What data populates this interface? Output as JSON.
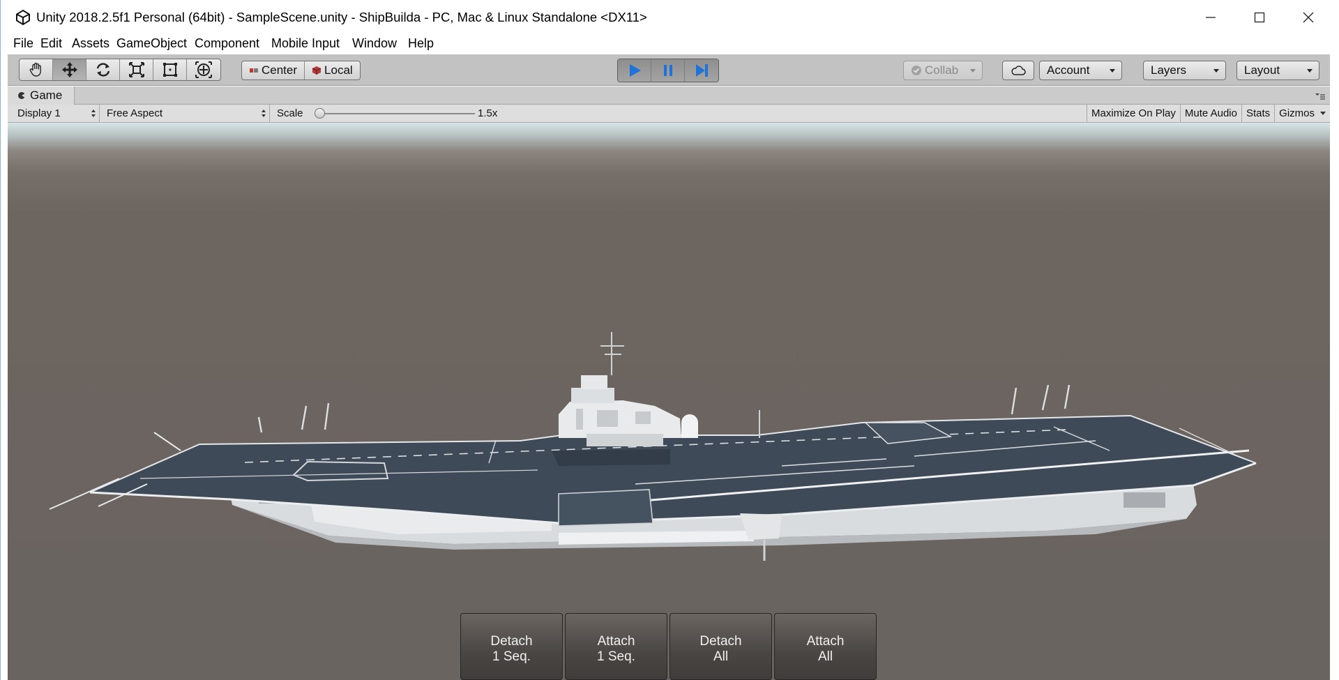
{
  "window": {
    "title": "Unity 2018.2.5f1 Personal (64bit) - SampleScene.unity - ShipBuilda - PC, Mac & Linux Standalone <DX11>"
  },
  "menu": {
    "items": [
      "File",
      "Edit",
      "Assets",
      "GameObject",
      "Component",
      "Mobile Input",
      "Window",
      "Help"
    ]
  },
  "toolbar": {
    "tools": [
      "hand-tool",
      "move-tool",
      "rotate-tool",
      "scale-tool",
      "rect-tool",
      "transform-tool"
    ],
    "active_tool": "move-tool",
    "pivot_label": "Center",
    "space_label": "Local",
    "collab_label": "Collab",
    "account_label": "Account",
    "layers_label": "Layers",
    "layout_label": "Layout",
    "accent_color": "#1e72d8"
  },
  "game_view": {
    "tab_label": "Game",
    "display": "Display 1",
    "aspect": "Free Aspect",
    "scale_label": "Scale",
    "scale_value": "1.5x",
    "maximize_label": "Maximize On Play",
    "mute_label": "Mute Audio",
    "stats_label": "Stats",
    "gizmos_label": "Gizmos"
  },
  "buttons": [
    {
      "line1": "Detach",
      "line2": "1 Seq."
    },
    {
      "line1": "Attach",
      "line2": "1 Seq."
    },
    {
      "line1": "Detach",
      "line2": "All"
    },
    {
      "line1": "Attach",
      "line2": "All"
    }
  ]
}
